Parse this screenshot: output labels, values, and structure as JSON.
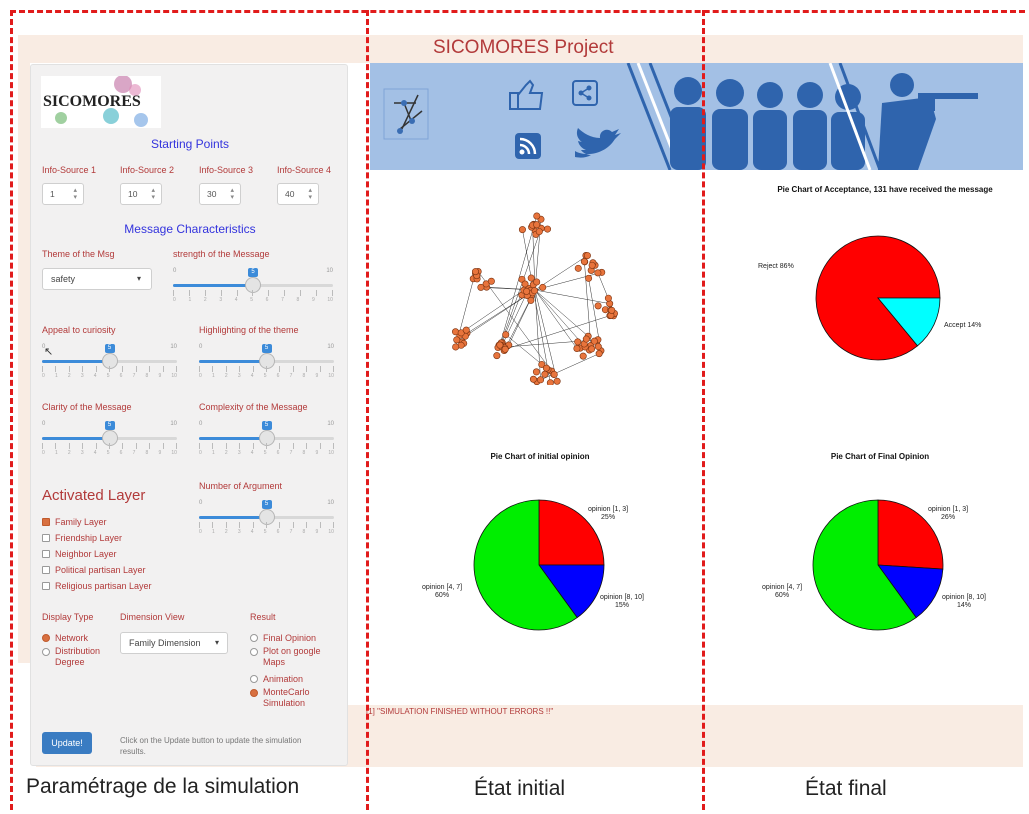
{
  "app": {
    "title": "SICOMORES Project",
    "logo_text": "SICOMORES"
  },
  "sidebar": {
    "starting_points_heading": "Starting Points",
    "info_sources": [
      {
        "label": "Info-Source 1",
        "value": "1"
      },
      {
        "label": "Info-Source 2",
        "value": "10"
      },
      {
        "label": "Info-Source 3",
        "value": "30"
      },
      {
        "label": "Info-Source 4",
        "value": "40"
      }
    ],
    "message_heading": "Message Characteristics",
    "theme": {
      "label": "Theme of the Msg",
      "value": "safety"
    },
    "sliders": [
      {
        "label": "strength of the Message",
        "min": "0",
        "max": "10",
        "value": "5",
        "ticks": [
          "0",
          "1",
          "2",
          "3",
          "4",
          "5",
          "6",
          "7",
          "8",
          "9",
          "10"
        ]
      },
      {
        "label": "Appeal to curiosity",
        "min": "0",
        "max": "10",
        "value": "5",
        "ticks": [
          "0",
          "1",
          "2",
          "3",
          "4",
          "5",
          "6",
          "7",
          "8",
          "9",
          "10"
        ]
      },
      {
        "label": "Highlighting of the theme",
        "min": "0",
        "max": "10",
        "value": "5",
        "ticks": [
          "0",
          "1",
          "2",
          "3",
          "4",
          "5",
          "6",
          "7",
          "8",
          "9",
          "10"
        ]
      },
      {
        "label": "Clarity of the Message",
        "min": "0",
        "max": "10",
        "value": "5",
        "ticks": [
          "0",
          "1",
          "2",
          "3",
          "4",
          "5",
          "6",
          "7",
          "8",
          "9",
          "10"
        ]
      },
      {
        "label": "Complexity of the Message",
        "min": "0",
        "max": "10",
        "value": "5",
        "ticks": [
          "0",
          "1",
          "2",
          "3",
          "4",
          "5",
          "6",
          "7",
          "8",
          "9",
          "10"
        ]
      },
      {
        "label": "Number of Argument",
        "min": "0",
        "max": "10",
        "value": "5",
        "ticks": [
          "0",
          "1",
          "2",
          "3",
          "4",
          "5",
          "6",
          "7",
          "8",
          "9",
          "10"
        ]
      }
    ],
    "layers_heading": "Activated Layer",
    "layers": [
      {
        "label": "Family Layer",
        "checked": true
      },
      {
        "label": "Friendship Layer",
        "checked": false
      },
      {
        "label": "Neighbor Layer",
        "checked": false
      },
      {
        "label": "Political partisan Layer",
        "checked": false
      },
      {
        "label": "Religious partisan Layer",
        "checked": false
      }
    ],
    "display_type": {
      "label": "Display Type",
      "options": [
        {
          "label": "Network",
          "selected": true
        },
        {
          "label": "Distribution Degree",
          "selected": false
        }
      ]
    },
    "dimension_view": {
      "label": "Dimension View",
      "value": "Family Dimension"
    },
    "result": {
      "label": "Result",
      "options": [
        {
          "label": "Final Opinion",
          "selected": false
        },
        {
          "label": "Plot on google Maps",
          "selected": false
        },
        {
          "label": "Animation",
          "selected": false
        },
        {
          "label": "MonteCarlo Simulation",
          "selected": true
        }
      ]
    },
    "update_button": "Update!",
    "update_hint": "Click on the Update button to update the simulation results."
  },
  "main": {
    "status_text": "[1] \"SIMULATION FINISHED WITHOUT ERRORS !!\"",
    "acceptance_chart_title": "Pie Chart of Acceptance,  131 have received the message",
    "initial_chart_title": "Pie Chart of initial opinion",
    "final_chart_title": "Pie Chart of Final Opinion"
  },
  "captions": {
    "setup": "Paramétrage de la simulation",
    "initial": "État initial",
    "final": "État final"
  },
  "colors": {
    "red": "#ff0000",
    "cyan": "#00ffff",
    "green": "#00ee00",
    "blue": "#0000ff",
    "node": "#e8743c",
    "banner": "#a3c0e5",
    "accent": "#3c8bd9"
  },
  "chart_data": [
    {
      "type": "pie",
      "title": "Pie Chart of Acceptance,  131 have received the message",
      "categories": [
        "Reject 86%",
        "Accept 14%"
      ],
      "values": [
        86,
        14
      ],
      "colors": [
        "#ff0000",
        "#00ffff"
      ]
    },
    {
      "type": "pie",
      "title": "Pie Chart of initial opinion",
      "categories": [
        "opinion [1, 3]\n25%",
        "opinion [8, 10]\n15%",
        "opinion [4, 7]\n60%"
      ],
      "values": [
        25,
        15,
        60
      ],
      "colors": [
        "#ff0000",
        "#0000ff",
        "#00ee00"
      ]
    },
    {
      "type": "pie",
      "title": "Pie Chart of Final Opinion",
      "categories": [
        "opinion [1, 3]\n26%",
        "opinion [8, 10]\n14%",
        "opinion [4, 7]\n60%"
      ],
      "values": [
        26,
        14,
        60
      ],
      "colors": [
        "#ff0000",
        "#0000ff",
        "#00ee00"
      ]
    }
  ]
}
